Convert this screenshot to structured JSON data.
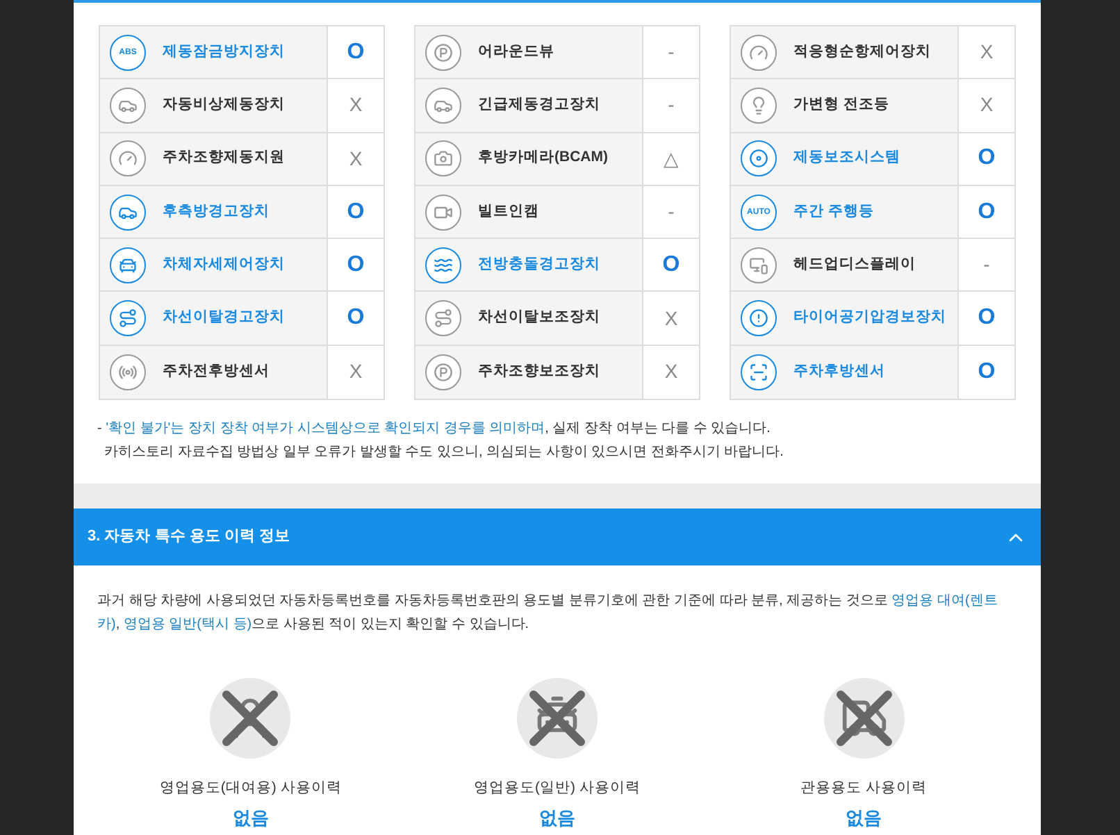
{
  "feature_columns": [
    [
      {
        "name": "제동잠금방지장치",
        "status": "O",
        "active": true,
        "icon_text": "ABS"
      },
      {
        "name": "자동비상제동장치",
        "status": "X",
        "active": false
      },
      {
        "name": "주차조향제동지원",
        "status": "X",
        "active": false
      },
      {
        "name": "후측방경고장치",
        "status": "O",
        "active": true
      },
      {
        "name": "차체자세제어장치",
        "status": "O",
        "active": true
      },
      {
        "name": "차선이탈경고장치",
        "status": "O",
        "active": true
      },
      {
        "name": "주차전후방센서",
        "status": "X",
        "active": false
      }
    ],
    [
      {
        "name": "어라운드뷰",
        "status": "-",
        "active": false
      },
      {
        "name": "긴급제동경고장치",
        "status": "-",
        "active": false
      },
      {
        "name": "후방카메라(BCAM)",
        "status": "△",
        "active": false
      },
      {
        "name": "빌트인캠",
        "status": "-",
        "active": false
      },
      {
        "name": "전방충돌경고장치",
        "status": "O",
        "active": true
      },
      {
        "name": "차선이탈보조장치",
        "status": "X",
        "active": false
      },
      {
        "name": "주차조향보조장치",
        "status": "X",
        "active": false
      }
    ],
    [
      {
        "name": "적응형순항제어장치",
        "status": "X",
        "active": false
      },
      {
        "name": "가변형 전조등",
        "status": "X",
        "active": false
      },
      {
        "name": "제동보조시스템",
        "status": "O",
        "active": true
      },
      {
        "name": "주간 주행등",
        "status": "O",
        "active": true,
        "icon_text": "AUTO"
      },
      {
        "name": "헤드업디스플레이",
        "status": "-",
        "active": false
      },
      {
        "name": "타이어공기압경보장치",
        "status": "O",
        "active": true
      },
      {
        "name": "주차후방센서",
        "status": "O",
        "active": true
      }
    ]
  ],
  "notes": [
    [
      {
        "text": "- ",
        "highlight": false
      },
      {
        "text": "'확인 불가'는 장치 장착 여부가 시스템상으로 확인되지 경우를 의미하며",
        "highlight": true
      },
      {
        "text": ", 실제 장착 여부는 다를 수 있습니다.",
        "highlight": false
      }
    ],
    [
      {
        "text": "카히스토리 자료수집 방법상 일부 오류가 발생할 수도 있으니, 의심되는 사항이 있으시면 전화주시기 바랍니다.",
        "highlight": false
      }
    ]
  ],
  "section": {
    "title": "3. 자동차 특수 용도 이력 정보",
    "expanded": true,
    "description": [
      {
        "text": "과거 해당 차량에 사용되었던 자동차등록번호를 자동차등록번호판의 용도별 분류기호에 관한 기준에 따라 분류, 제공하는 것으로 ",
        "highlight": false
      },
      {
        "text": "영업용 대여(렌트카)",
        "highlight": true
      },
      {
        "text": ", ",
        "highlight": false
      },
      {
        "text": "영업용 일반(택시 등)",
        "highlight": true
      },
      {
        "text": "으로 사용된 적이 있는지 확인할 수 있습니다.",
        "highlight": false
      }
    ],
    "usages": [
      {
        "kind": "rental",
        "label": "영업용도(대여용) 사용이력",
        "value": "없음"
      },
      {
        "kind": "taxi",
        "label": "영업용도(일반) 사용이력",
        "value": "없음"
      },
      {
        "kind": "government",
        "label": "관용용도 사용이력",
        "value": "없음"
      }
    ]
  }
}
